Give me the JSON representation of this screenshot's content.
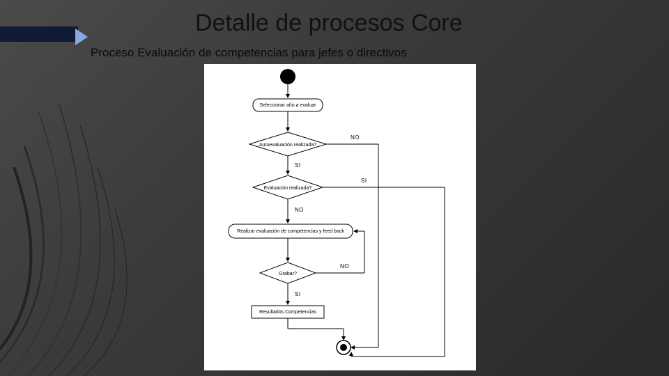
{
  "title": "Detalle de procesos Core",
  "subtitle": "Proceso Evaluación de competencias para jefes o directivos",
  "flowchart": {
    "start": "",
    "step_select_year": "Seleccionar año a evaluar",
    "decision_autoeval": "Autoevaluación realizada?",
    "decision_autoeval_no": "NO",
    "decision_autoeval_yes": "SI",
    "decision_eval_done": "Evaluación realizada?",
    "decision_eval_done_yes": "SI",
    "decision_eval_done_no": "NO",
    "step_perform_eval": "Realizar evaluación de competencias y feed back",
    "decision_save": "Grabar?",
    "decision_save_no": "NO",
    "decision_save_yes": "SI",
    "step_results": "Resultados Competencias",
    "end": ""
  }
}
